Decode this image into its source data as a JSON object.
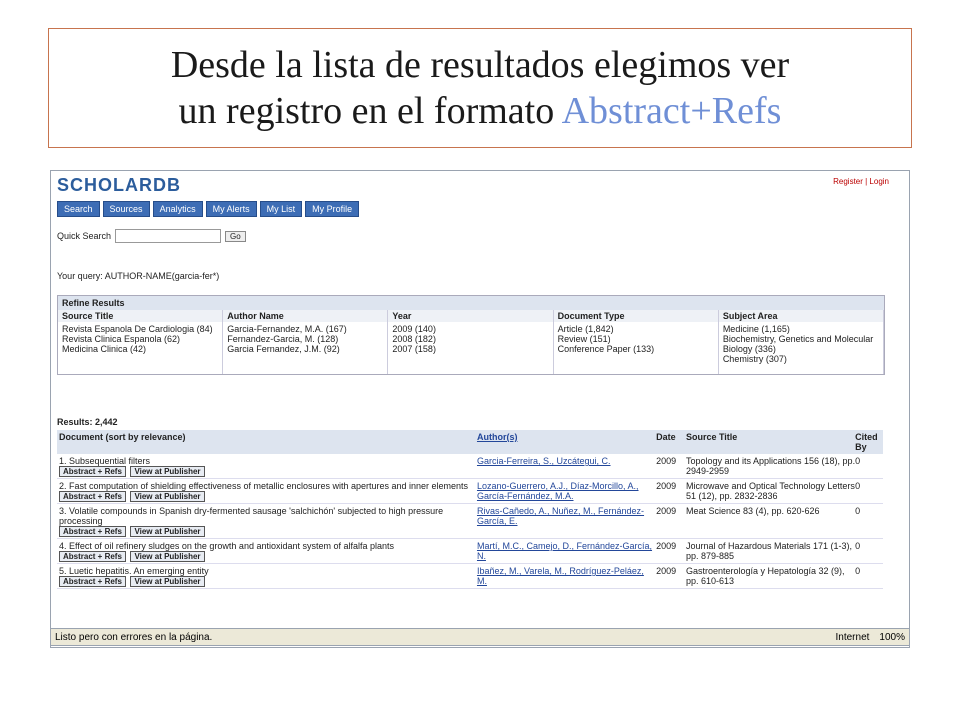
{
  "banner": {
    "line1": "Desde la lista de resultados  elegimos ver",
    "line2a": "un registro en el formato ",
    "line2b": "Abstract+Refs"
  },
  "app": {
    "brand": "SCHOLARDB",
    "top_links": "Register | Login"
  },
  "nav": [
    "Search",
    "Sources",
    "Analytics",
    "My Alerts",
    "My List",
    "My Profile"
  ],
  "search": {
    "label": "Quick Search",
    "go": "Go",
    "query": "Your query: AUTHOR-NAME(garcia-fer*)"
  },
  "refine": {
    "title": "Refine Results",
    "columns": [
      {
        "title": "Source Title",
        "items": [
          "Revista Espanola De Cardiologia (84)",
          "Revista Clinica Espanola (62)",
          "Medicina Clinica (42)"
        ]
      },
      {
        "title": "Author Name",
        "items": [
          "Garcia-Fernandez, M.A. (167)",
          "Fernandez-Garcia, M. (128)",
          "Garcia Fernandez, J.M. (92)"
        ]
      },
      {
        "title": "Year",
        "items": [
          "2009 (140)",
          "2008 (182)",
          "2007 (158)"
        ]
      },
      {
        "title": "Document Type",
        "items": [
          "Article (1,842)",
          "Review (151)",
          "Conference Paper (133)"
        ]
      },
      {
        "title": "Subject Area",
        "items": [
          "Medicine (1,165)",
          "Biochemistry, Genetics and Molecular Biology (336)",
          "Chemistry (307)"
        ]
      }
    ]
  },
  "results": {
    "count": "Results: 2,442",
    "headers": [
      "Document (sort by relevance)",
      "Author(s)",
      "Date",
      "Source Title",
      "Cited By"
    ],
    "abstract_label": "Abstract + Refs",
    "publisher_label": "View at Publisher",
    "rows": [
      {
        "title": "1. Subsequential filters",
        "authors": "Garcia-Ferreira, S., Uzcátegui, C.",
        "year": "2009",
        "source": "Topology and its Applications 156 (18), pp. 2949-2959",
        "cited": "0"
      },
      {
        "title": "2. Fast computation of shielding effectiveness of metallic enclosures with apertures and inner elements",
        "authors": "Lozano-Guerrero, A.J., Díaz-Morcillo, A., García-Fernández, M.A.",
        "year": "2009",
        "source": "Microwave and Optical Technology Letters 51 (12), pp. 2832-2836",
        "cited": "0"
      },
      {
        "title": "3. Volatile compounds in Spanish dry-fermented sausage 'salchichón' subjected to high pressure processing",
        "authors": "Rivas-Cañedo, A., Nuñez, M., Fernández-García, E.",
        "year": "2009",
        "source": "Meat Science 83 (4), pp. 620-626",
        "cited": "0"
      },
      {
        "title": "4. Effect of oil refinery sludges on the growth and antioxidant system of alfalfa plants",
        "authors": "Martí, M.C., Camejo, D., Fernández-García, N.",
        "year": "2009",
        "source": "Journal of Hazardous Materials 171 (1-3), pp. 879-885",
        "cited": "0"
      },
      {
        "title": "5. Luetic hepatitis. An emerging entity",
        "authors": "Ibañez, M., Varela, M., Rodríguez-Peláez, M.",
        "year": "2009",
        "source": "Gastroenterología y Hepatología 32 (9), pp. 610-613",
        "cited": "0"
      }
    ]
  },
  "status": {
    "left": "Listo pero con errores en la página.",
    "zone": "Internet",
    "zoom": "100%"
  }
}
